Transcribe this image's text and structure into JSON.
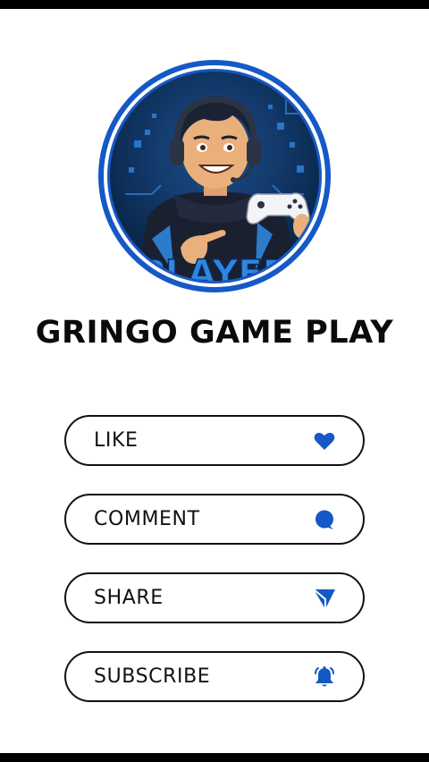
{
  "profile": {
    "channel_name": "GRINGO GAME PLAY",
    "logo_text": "PLAYER"
  },
  "actions": [
    {
      "label": "LIKE",
      "icon": "heart-icon"
    },
    {
      "label": "COMMENT",
      "icon": "speech-bubble-icon"
    },
    {
      "label": "SHARE",
      "icon": "paper-plane-icon"
    },
    {
      "label": "SUBSCRIBE",
      "icon": "bell-icon"
    }
  ],
  "colors": {
    "accent": "#1559c6",
    "text": "#111111",
    "background": "#ffffff",
    "frame": "#000000"
  }
}
